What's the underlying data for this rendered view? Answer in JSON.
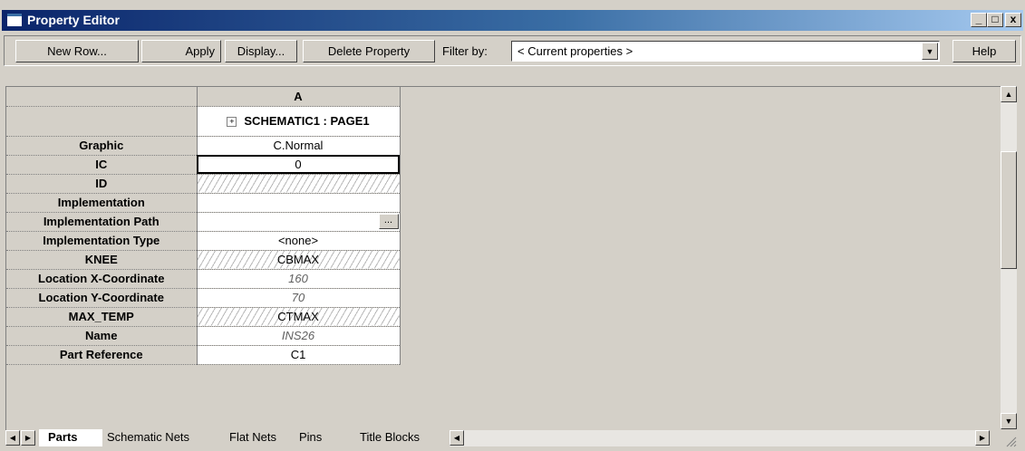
{
  "window": {
    "title": "Property Editor",
    "minimize": "_",
    "maximize": "□",
    "close": "x"
  },
  "toolbar": {
    "new_row": "New Row...",
    "apply": "Apply",
    "display": "Display...",
    "delete_property": "Delete Property",
    "filter_label": "Filter by:",
    "filter_value": "< Current properties >",
    "help": "Help"
  },
  "grid": {
    "column_header": "A",
    "group_header": "SCHEMATIC1 : PAGE1",
    "rows": [
      {
        "name": "Graphic",
        "value": "C.Normal",
        "style": "normal"
      },
      {
        "name": "IC",
        "value": "0",
        "style": "selected"
      },
      {
        "name": "ID",
        "value": "",
        "style": "hatch"
      },
      {
        "name": "Implementation",
        "value": "",
        "style": "normal"
      },
      {
        "name": "Implementation Path",
        "value": "",
        "style": "ellipsis"
      },
      {
        "name": "Implementation Type",
        "value": "<none>",
        "style": "normal"
      },
      {
        "name": "KNEE",
        "value": "CBMAX",
        "style": "hatch"
      },
      {
        "name": "Location X-Coordinate",
        "value": "160",
        "style": "italic"
      },
      {
        "name": "Location Y-Coordinate",
        "value": "70",
        "style": "italic"
      },
      {
        "name": "MAX_TEMP",
        "value": "CTMAX",
        "style": "hatch"
      },
      {
        "name": "Name",
        "value": "INS26",
        "style": "italic"
      },
      {
        "name": "Part Reference",
        "value": "C1",
        "style": "normal"
      }
    ]
  },
  "tabs": [
    {
      "label": "Parts",
      "active": true
    },
    {
      "label": "Schematic Nets",
      "active": false
    },
    {
      "label": "Flat Nets",
      "active": false
    },
    {
      "label": "Pins",
      "active": false
    },
    {
      "label": "Title Blocks",
      "active": false
    }
  ],
  "colors": {
    "title_start": "#0a246a",
    "title_end": "#a6caf0",
    "face": "#d4d0c8"
  }
}
